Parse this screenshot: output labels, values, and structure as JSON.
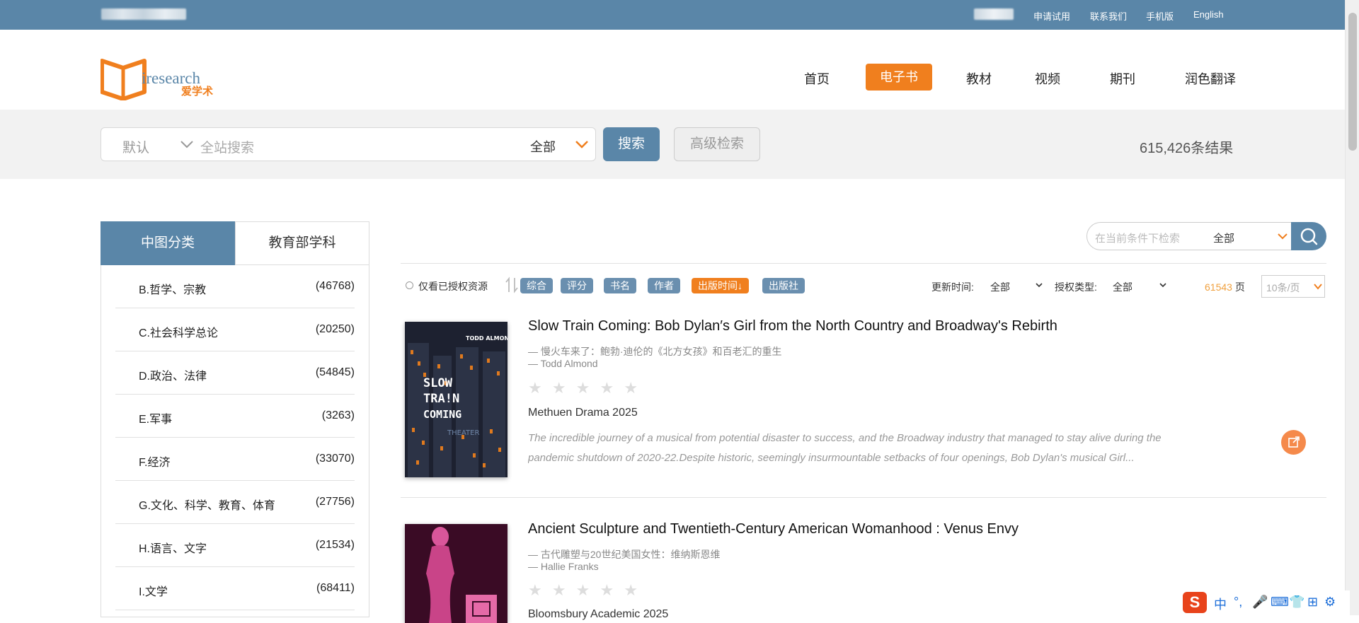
{
  "topbar": {
    "links": [
      "申请试用",
      "联系我们",
      "手机版",
      "English"
    ]
  },
  "logo": {
    "name": "iresearch",
    "sub": "爱学术"
  },
  "nav": {
    "items": [
      "首页",
      "电子书",
      "教材",
      "视频",
      "期刊",
      "润色翻译"
    ],
    "active": "电子书"
  },
  "search": {
    "scope_default": "默认",
    "placeholder": "全站搜索",
    "type_all": "全部",
    "button": "搜索",
    "advanced": "高级检索",
    "result_count": "615,426条结果"
  },
  "sidebar": {
    "tabs": [
      "中图分类",
      "教育部学科"
    ],
    "categories": [
      {
        "name": "B.哲学、宗教",
        "count": "(46768)"
      },
      {
        "name": "C.社会科学总论",
        "count": "(20250)"
      },
      {
        "name": "D.政治、法律",
        "count": "(54845)"
      },
      {
        "name": "E.军事",
        "count": "(3263)"
      },
      {
        "name": "F.经济",
        "count": "(33070)"
      },
      {
        "name": "G.文化、科学、教育、体育",
        "count": "(27756)"
      },
      {
        "name": "H.语言、文字",
        "count": "(21534)"
      },
      {
        "name": "I.文学",
        "count": "(68411)"
      }
    ]
  },
  "filter": {
    "placeholder": "在当前条件下检索",
    "all": "全部",
    "authorized_only": "仅看已授权资源",
    "sort": [
      "综合",
      "评分",
      "书名",
      "作者",
      "出版时间↓",
      "出版社"
    ],
    "sort_active": "出版时间↓",
    "update_label": "更新时间:",
    "update_value": "全部",
    "license_label": "授权类型:",
    "license_value": "全部",
    "page_count": "61543",
    "page_unit": "页",
    "per_page": "10条/页"
  },
  "books": [
    {
      "title": "Slow Train Coming: Bob Dylan′s Girl from the North Country and Broadway's Rebirth",
      "subtitle": "— 慢火车来了：鲍勃·迪伦的《北方女孩》和百老汇的重生",
      "author": "— Todd Almond",
      "stars": "★ ★ ★ ★ ★",
      "publisher": "Methuen Drama 2025",
      "abstract": "The incredible journey of a musical from potential disaster to success, and the Broadway industry that managed to stay alive during the pandemic shutdown of 2020-22.Despite historic, seemingly insurmountable setbacks of four openings, Bob Dylan's musical Girl...",
      "cover_author": "TODD ALMOND",
      "cover_title": "SLOW TRA!N COMING",
      "cover_word": "THEATER"
    },
    {
      "title": "Ancient Sculpture and Twentieth-Century American Womanhood : Venus Envy",
      "subtitle": "— 古代雕塑与20世纪美国女性：维纳斯恩维",
      "author": "— Hallie Franks",
      "stars": "★ ★ ★ ★ ★",
      "publisher": "Bloomsbury Academic 2025"
    }
  ],
  "ime": {
    "logo": "S",
    "glyphs": [
      "中",
      "°,",
      "🎤",
      "⌨",
      "👕",
      "⊞",
      "⚙"
    ]
  }
}
